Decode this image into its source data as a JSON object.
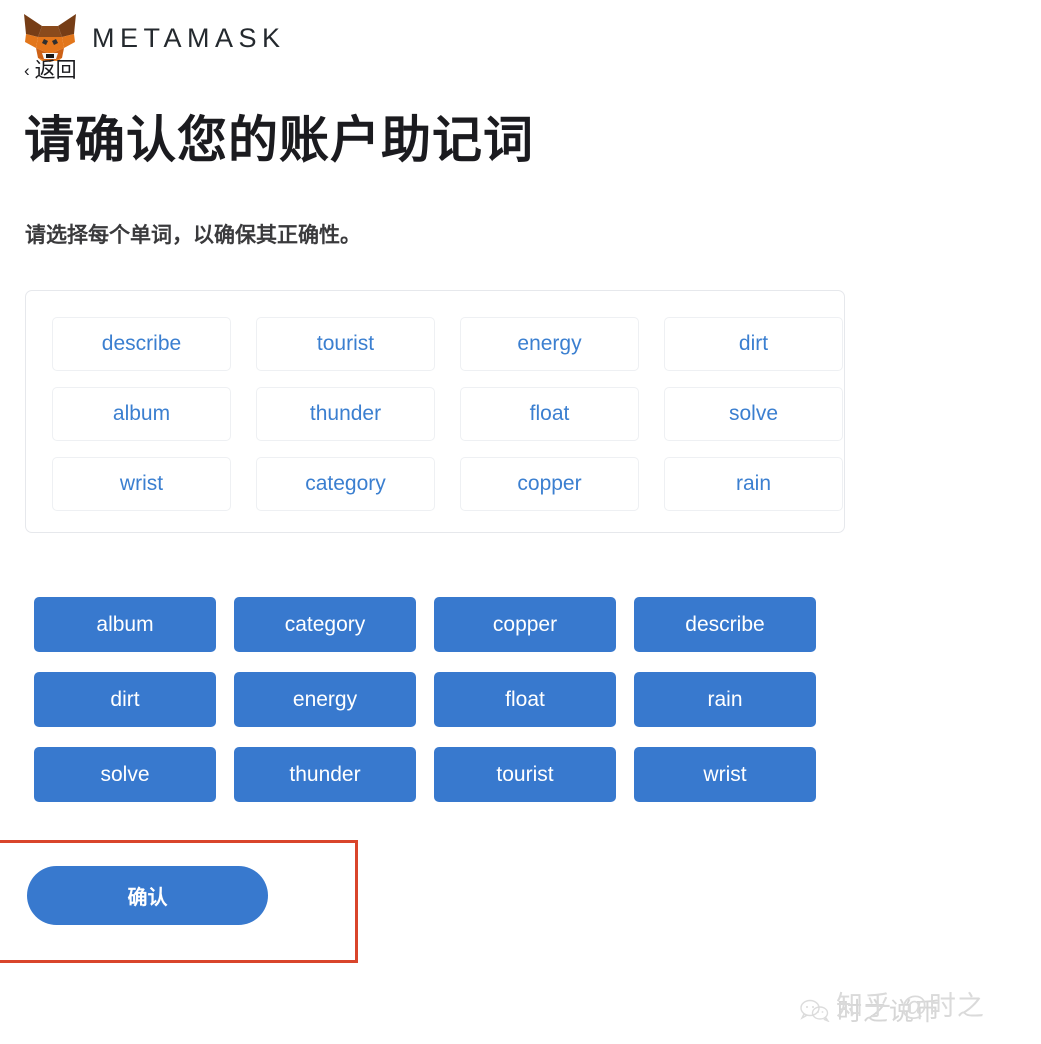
{
  "brand": {
    "logo_icon": "metamask-fox-icon",
    "wordmark": "METAMASK"
  },
  "back": {
    "chevron": "‹",
    "label": "返回"
  },
  "page": {
    "title": "请确认您的账户助记词",
    "subtitle": "请选择每个单词，以确保其正确性。"
  },
  "selected_panel": {
    "words": [
      "describe",
      "tourist",
      "energy",
      "dirt",
      "album",
      "thunder",
      "float",
      "solve",
      "wrist",
      "category",
      "copper",
      "rain"
    ]
  },
  "word_bank": {
    "words": [
      "album",
      "category",
      "copper",
      "describe",
      "dirt",
      "energy",
      "float",
      "rain",
      "solve",
      "thunder",
      "tourist",
      "wrist"
    ]
  },
  "confirm": {
    "label": "确认"
  },
  "watermarks": {
    "wechat": "时之说币",
    "zhihu": "知乎 @时之"
  },
  "colors": {
    "accent_blue": "#3879ce",
    "chip_text_blue": "#3b7fd0",
    "annotation_red": "#d9452b",
    "panel_border": "#e6e8ec",
    "text_dark": "#1b1b1f"
  }
}
